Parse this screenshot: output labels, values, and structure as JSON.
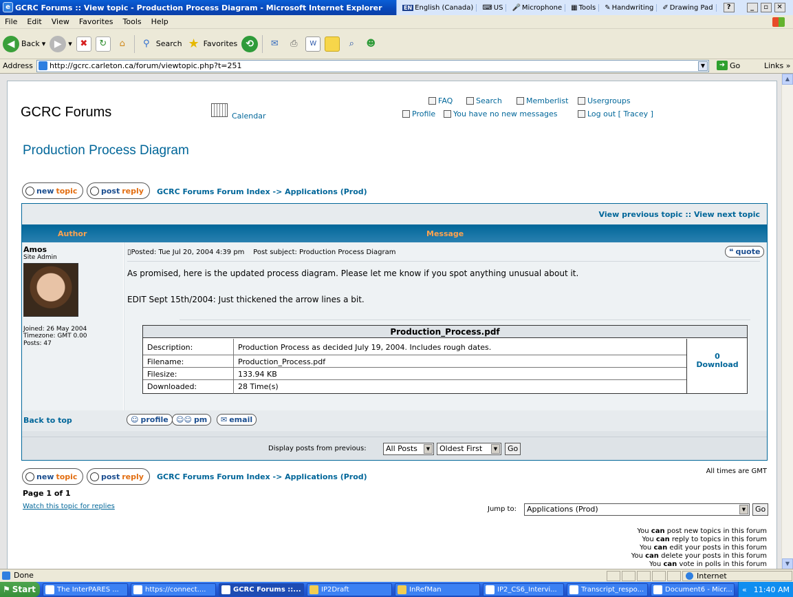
{
  "window": {
    "title": "GCRC Forums :: View topic - Production Process Diagram - Microsoft Internet Explorer",
    "langbar": [
      "English (Canada)",
      "US",
      "Microphone",
      "Tools",
      "Handwriting",
      "Drawing Pad"
    ],
    "lang_code": "EN"
  },
  "menu": [
    "File",
    "Edit",
    "View",
    "Favorites",
    "Tools",
    "Help"
  ],
  "toolbar": {
    "back": "Back",
    "search": "Search",
    "favorites": "Favorites"
  },
  "address": {
    "label": "Address",
    "url": "http://gcrc.carleton.ca/forum/viewtopic.php?t=251",
    "go": "Go",
    "links": "Links"
  },
  "header": {
    "site_title": "GCRC Forums",
    "calendar": "Calendar",
    "faq": "FAQ",
    "search": "Search",
    "memberlist": "Memberlist",
    "usergroups": "Usergroups",
    "profile": "Profile",
    "messages": "You have no new messages",
    "logout": "Log out [ Tracey ]"
  },
  "topic": {
    "title": "Production Process Diagram",
    "new_topic": {
      "pre": "new",
      "post": "topic"
    },
    "post_reply": {
      "pre": "post",
      "post": "reply"
    },
    "breadcrumb": "GCRC Forums Forum Index -> Applications (Prod)",
    "nav": "View previous topic :: View next topic",
    "col_author": "Author",
    "col_message": "Message"
  },
  "post": {
    "author": "Amos",
    "rank": "Site Admin",
    "joined": "Joined: 26 May 2004",
    "timezone": "Timezone: GMT 0.00",
    "posts": "Posts: 47",
    "posted": "Posted: Tue Jul 20, 2004 4:39 pm",
    "subject": "Post subject: Production Process Diagram",
    "quote": "quote",
    "body1": "As promised, here is the updated process diagram. Please let me know if you spot anything unusual about it.",
    "body2": "EDIT Sept 15th/2004: Just thickened the arrow lines a bit.",
    "back_to_top": "Back to top",
    "profile_btn": "profile",
    "pm_btn": "pm",
    "email_btn": "email"
  },
  "attachment": {
    "title": "Production_Process.pdf",
    "rows": [
      {
        "k": "Description:",
        "v": "Production Process as decided July 19, 2004. Includes rough dates."
      },
      {
        "k": "Filename:",
        "v": "Production_Process.pdf"
      },
      {
        "k": "Filesize:",
        "v": "133.94 KB"
      },
      {
        "k": "Downloaded:",
        "v": "28 Time(s)"
      }
    ],
    "download": "Download",
    "zero": "0"
  },
  "display": {
    "label": "Display posts from previous:",
    "posts_value": "All Posts",
    "order_value": "Oldest First",
    "go": "Go"
  },
  "footer": {
    "timezone_note": "All times are GMT",
    "page": "Page 1 of 1",
    "watch": "Watch this topic for replies",
    "jump_label": "Jump to:",
    "jump_value": "Applications (Prod)",
    "go": "Go",
    "permissions_can": "can",
    "permissions": [
      {
        "pre": "You",
        "post": "post new topics in this forum"
      },
      {
        "pre": "You",
        "post": "reply to topics in this forum"
      },
      {
        "pre": "You",
        "post": "edit your posts in this forum"
      },
      {
        "pre": "You",
        "post": "delete your posts in this forum"
      },
      {
        "pre": "You",
        "post": "vote in polls in this forum"
      }
    ]
  },
  "status": {
    "text": "Done",
    "zone": "Internet"
  },
  "taskbar": {
    "start": "Start",
    "tasks": [
      "The InterPARES ...",
      "https://connect....",
      "GCRC Forums ::...",
      "IP2Draft",
      "InRefMan",
      "IP2_CS6_Intervi...",
      "Transcript_respo...",
      "Document6 - Micr..."
    ],
    "clock": "11:40 AM",
    "chevron": "«"
  },
  "colors": {
    "link": "#006699",
    "header_orange": "#ffa34f",
    "title_blue": "#0847b8"
  }
}
